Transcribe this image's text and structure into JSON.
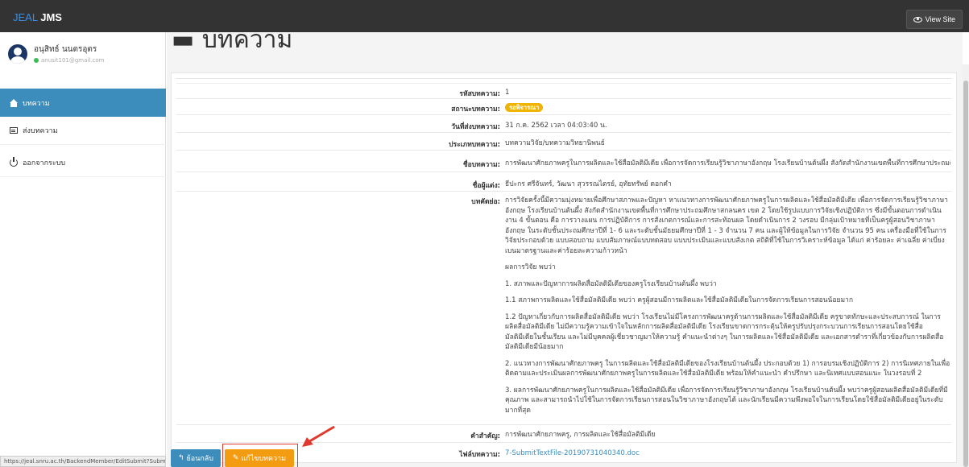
{
  "app": {
    "brand_prefix": "JEAL",
    "brand_name": "JMS",
    "view_site": "View Site"
  },
  "user": {
    "name": "อนุสิทธ์ นนตรอุตร",
    "email": "anusit101@gmail.com"
  },
  "nav": [
    {
      "label": "บทความ",
      "icon": "home-icon",
      "active": true
    },
    {
      "label": "ส่งบทความ",
      "icon": "list-icon",
      "active": false
    },
    {
      "label": "ออกจากระบบ",
      "icon": "power-icon",
      "active": false
    }
  ],
  "page": {
    "heading": "บทความ"
  },
  "article": {
    "id_label": "รหัสบทความ:",
    "id": "1",
    "status_label": "สถานะบทความ:",
    "status": "รอพิจารณา",
    "submit_date_label": "วันที่ส่งบทความ:",
    "submit_date": "31 ก.ค. 2562 เวลา 04:03:40 น.",
    "type_label": "ประเภทบทความ:",
    "type": "บทความวิจัย/บทความวิทยานิพนธ์",
    "title_label": "ชื่อบทความ:",
    "title": "การพัฒนาศักยภาพครูในการผลิตและใช้สื่อมัลติมีเดีย เพื่อการจัดการเรียนรู้วิชาภาษาอังกฤษ โรงเรียนบ้านต้นผึ้ง สังกัดสำนักงานเขตพื้นที่การศึกษาประถมศึกษาสกลนคร เขต 2",
    "authors_label": "ชื่อผู้แต่ง:",
    "authors": "ธีปะกร ศรีจันทร์, วัฒนา สุวรรณไตรย์, อุทัยทรัพย์ ดอกคำ",
    "abstract_label": "บทคัดย่อ:",
    "abstract": [
      "การวิจัยครั้งนี้มีความมุ่งหมายเพื่อศึกษาสภาพและปัญหา หาแนวทางการพัฒนาศักยภาพครูในการผลิตและใช้สื่อมัลติมีเดีย เพื่อการจัดการเรียนรู้วิชาภาษาอังกฤษ โรงเรียนบ้านต้นผึ้ง สังกัดสำนักงานเขตพื้นที่การศึกษาประถมศึกษาสกลนคร เขต 2 โดยใช้รูปแบบการวิจัยเชิงปฏิบัติการ ซึ่งมีขั้นตอนการดำเนินงาน 4 ขั้นตอน คือ การวางแผน การปฏิบัติการ การสังเกตการณ์และการสะท้อนผล โดยดำเนินการ 2 วงรอบ มีกลุ่มเป้าหมายที่เป็นครูผู้สอนวิชาภาษาอังกฤษ ในระดับชั้นประถมศึกษาปีที่ 1- 6 และระดับชั้นมัธยมศึกษาปีที่ 1 - 3 จำนวน 7 คน และผู้ให้ข้อมูลในการวิจัย จำนวน 95 คน เครื่องมือที่ใช้ในการวิจัยประกอบด้วย แบบสอบถาม แบบสัมภาษณ์แบบทดสอบ แบบประเมินและแบบสังเกต สถิติที่ใช้ในการวิเคราะห์ข้อมูล ได้แก่ ค่าร้อยละ ค่าเฉลี่ย ค่าเบี่ยงเบนมาตรฐานและค่าร้อยละความก้าวหน้า",
      "ผลการวิจัย พบว่า",
      "1. สภาพและปัญหาการผลิตสื่อมัลติมีเดียของครูโรงเรียนบ้านต้นผึ้ง พบว่า",
      "1.1 สภาพการผลิตและใช้สื่อมัลติมีเดีย พบว่า ครูผู้สอนมีการผลิตและใช้สื่อมัลติมีเดียในการจัดการเรียนการสอนน้อยมาก",
      "1.2 ปัญหาเกี่ยวกับการผลิตสื่อมัลติมีเดีย พบว่า โรงเรียนไม่มีโครงการพัฒนาครูด้านการผลิตและใช้สื่อมัลติมีเดีย ครูขาดทักษะและประสบการณ์ ในการผลิตสื่อมัลติมีเดีย ไม่มีความรู้ความเข้าใจในหลักการผลิตสื่อมัลติมีเดีย โรงเรียนขาดการกระตุ้นให้ครูปรับปรุงกระบวนการเรียนการสอนโดยใช้สื่อมัลติมีเดียในชั้นเรียน และไม่มีบุคคลผู้เชี่ยวชาญมาให้ความรู้ คำแนะนำต่างๆ ในการผลิตและใช้สื่อมัลติมีเดีย และเอกสารตำราที่เกี่ยวข้องกับการผลิตสื่อมัลติมีเดียมีน้อยมาก",
      "2. แนวทางการพัฒนาศักยภาพครู ในการผลิตและใช้สื่อมัลติมีเดียของโรงเรียนบ้านต้นผึ้ง ประกอบด้วย 1) การอบรมเชิงปฏิบัติการ 2) การนิเทศภายในเพื่อติดตามและประเมินผลการพัฒนาศักยภาพครูในการผลิตและใช้สื่อมัลติมีเดีย พร้อมให้คำแนะนำ คำปรึกษา และนิเทศแบบสอนแนะ ในวงรอบที่ 2",
      "3. ผลการพัฒนาศักยภาพครูในการผลิตและใช้สื่อมัลติมีเดีย เพื่อการจัดการเรียนรู้วิชาภาษาอังกฤษ โรงเรียนบ้านต้นผึ้ง พบว่าครูผู้สอนผลิตสื่อมัลติมีเดียที่มีคุณภาพ และสามารถนำไปใช้ในการจัดการเรียนการสอนในวิชาภาษาอังกฤษได้ และนักเรียนมีความพึงพอใจในการเรียนโดยใช้สื่อมัลติมีเดียอยู่ในระดับมากที่สุด"
    ],
    "keywords_label": "คำสำคัญ:",
    "keywords": "การพัฒนาศักยภาพครู, การผลิตและใช้สื่อมัลติมีเดีย",
    "file_label": "ไฟล์บทความ:",
    "file": "7-SubmitTextFile-20190731040340.doc"
  },
  "actions": {
    "back": "ย้อนกลับ",
    "edit": "แก้ไขบทความ"
  },
  "status_bar": {
    "url": "https://jeal.snru.ac.th/BackendMember/EditSubmit?SubmitID=1"
  }
}
